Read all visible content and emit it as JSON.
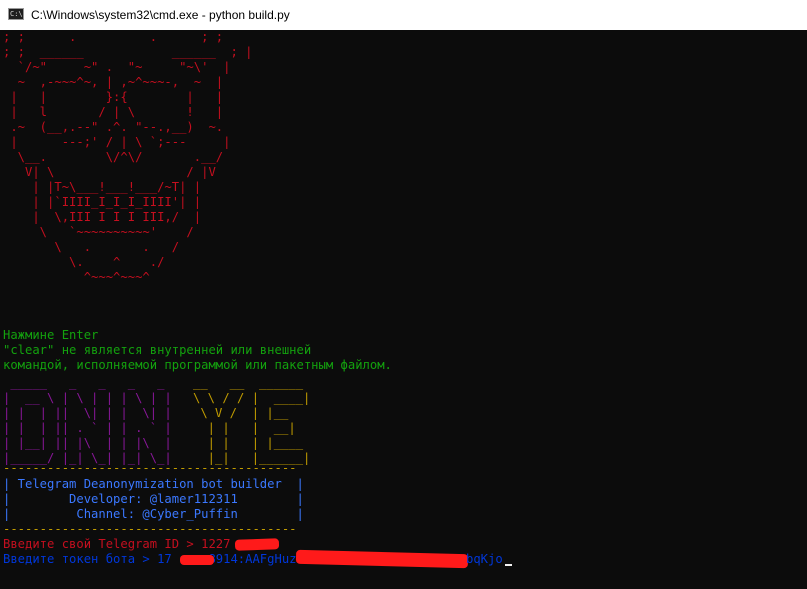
{
  "window": {
    "title": "C:\\Windows\\system32\\cmd.exe - python  build.py",
    "icon": "cmd-icon",
    "icon_text": "C:\\"
  },
  "skull": [
    "; ;      .          .      ; ;",
    "; ;  ______            ______  ; |",
    "  `/~\"     ~\" .  \"~     \"~\\'  |",
    "  ~  ,-~~~^~, | ,~^~~~-,  ~  |",
    " |   |        }:{        |   |",
    " |   l       / | \\       !   |",
    " .~  (__,.--\" .^. \"--.,__)  ~.",
    " |      ---;' / | \\ `;---     |",
    "  \\__.        \\/^\\/       .__/",
    "   V| \\                  / |V",
    "    | |T~\\___!___!___/~T| |",
    "    | |`IIII_I_I_I_IIII'| |",
    "    |  \\,III I I I III,/  |",
    "     \\   `~~~~~~~~~~'    /",
    "       \\   .       .   /",
    "         \\.    ^    ./",
    "           ^~~~^~~~^"
  ],
  "messages": {
    "press_enter": "Нажмине Enter",
    "clear_error_1": "\"clear\" не является внутренней или внешней",
    "clear_error_2": "командой, исполняемой программой или пакетным файлом."
  },
  "logo_left": [
    " _____   _   _   _   _",
    "|  __ \\ | \\ | | | \\ | |",
    "| |  | ||  \\| | |  \\| |",
    "| |  | || . ` | | . ` |",
    "| |__| || |\\  | | |\\  |",
    "|_____/ |_| \\_| |_| \\_|"
  ],
  "logo_right": [
    "__   __  ______",
    "\\ \\ / / |  ____|",
    " \\ V /  | |__",
    "  | |   |  __|",
    "  | |   | |____",
    "  |_|   |______|"
  ],
  "banner": {
    "border": "----------------------------------------",
    "line_1": "| Telegram Deanonymization bot builder  |",
    "line_2": "|        Developer: @lamer112311        |",
    "line_3": "|         Channel: @Cyber_Puffin        |"
  },
  "prompts": {
    "telegram_id": "Введите свой Telegram ID > 1227",
    "bot_token_prefix": "Введите токен бота > 17     8914:AAFgHuz",
    "bot_token_suffix": "bqKjo"
  },
  "colors": {
    "background": "#0c0c0c",
    "skull": "#c50f1f",
    "messages": "#13a10e",
    "logo_yellow": "#c19c00",
    "logo_purple": "#881798",
    "banner_text": "#3b78ff",
    "token_prompt": "#0037da",
    "redaction": "#ff1a1a"
  }
}
